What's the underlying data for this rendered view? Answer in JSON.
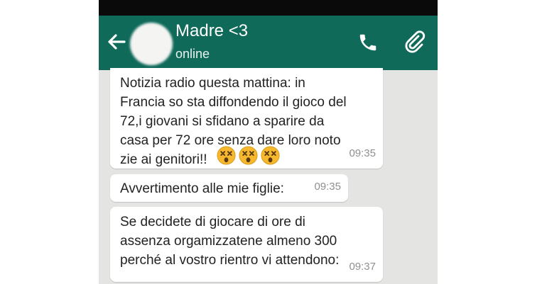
{
  "header": {
    "contact_name": "Madre <3",
    "status": "online"
  },
  "messages": [
    {
      "text": "Notizia radio questa mattina: in\nFrancia so sta diffondendo il gioco del\n72,i giovani si sfidano a sparire da\ncasa per 72 ore senza dare loro noto\nzie ai genitori!!",
      "emoji_count": 3,
      "emoji": "dizzy-face",
      "time": "09:35"
    },
    {
      "text": "Avvertimento alle mie figlie:",
      "time": "09:35"
    },
    {
      "text": "Se decidete di giocare di ore di\nassenza orgamizzatene almeno 300\nperché al vostro rientro  vi attendono:",
      "time": "09:37"
    }
  ],
  "colors": {
    "appbar": "#0f6a5a",
    "chat_background": "#e4e4e2",
    "bubble": "#ffffff",
    "emoji": "#f5b82e"
  },
  "icons": {
    "back": "arrow-left",
    "call": "phone",
    "attach": "paperclip"
  }
}
